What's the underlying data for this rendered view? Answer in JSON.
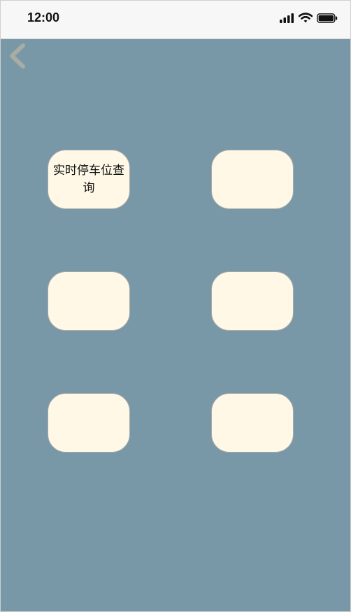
{
  "status_bar": {
    "time": "12:00",
    "icons": [
      "signal-icon",
      "wifi-icon",
      "battery-icon"
    ]
  },
  "header": {
    "back_icon": "chevron-left-icon"
  },
  "grid": {
    "tiles": [
      {
        "label": "实时停车位查询"
      },
      {
        "label": ""
      },
      {
        "label": ""
      },
      {
        "label": ""
      },
      {
        "label": ""
      },
      {
        "label": ""
      }
    ]
  },
  "colors": {
    "background": "#7898a8",
    "tile_fill": "#fff8e6",
    "tile_border": "#a9a9a9",
    "back_chevron": "#a9aca2",
    "status_bar": "#f7f7f7"
  }
}
